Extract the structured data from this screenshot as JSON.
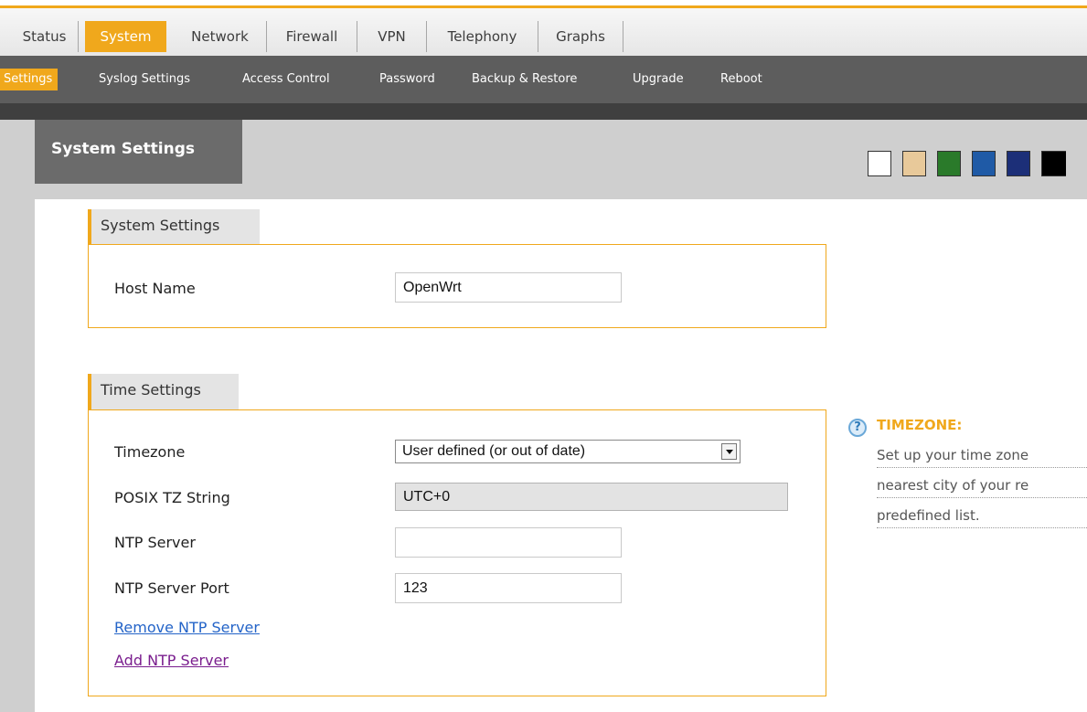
{
  "main_nav": {
    "tabs": [
      {
        "label": "Status",
        "active": false
      },
      {
        "label": "System",
        "active": true
      },
      {
        "label": "Network",
        "active": false
      },
      {
        "label": "Firewall",
        "active": false
      },
      {
        "label": "VPN",
        "active": false
      },
      {
        "label": "Telephony",
        "active": false
      },
      {
        "label": "Graphs",
        "active": false
      }
    ]
  },
  "sub_nav": {
    "items": [
      {
        "label": "Settings",
        "active": true
      },
      {
        "label": "Syslog Settings",
        "active": false
      },
      {
        "label": "Access Control",
        "active": false
      },
      {
        "label": "Password",
        "active": false
      },
      {
        "label": "Backup & Restore",
        "active": false
      },
      {
        "label": "Upgrade",
        "active": false
      },
      {
        "label": "Reboot",
        "active": false
      }
    ]
  },
  "page": {
    "heading": "System Settings"
  },
  "theme_swatches": [
    "#ffffff",
    "#e8c99a",
    "#2a7a2a",
    "#1f5aa6",
    "#1c2f78",
    "#000000"
  ],
  "system_section": {
    "title": "System Settings",
    "host_name_label": "Host Name",
    "host_name_value": "OpenWrt"
  },
  "time_section": {
    "title": "Time Settings",
    "timezone_label": "Timezone",
    "timezone_value": "User defined (or out of date)",
    "posix_label": "POSIX TZ String",
    "posix_value": "UTC+0",
    "ntp_server_label": "NTP Server",
    "ntp_server_value": "",
    "ntp_port_label": "NTP Server Port",
    "ntp_port_value": "123",
    "remove_link": "Remove NTP Server",
    "add_link": "Add NTP Server"
  },
  "help": {
    "icon": "question-icon",
    "title": "TIMEZONE:",
    "lines": [
      "Set up your time zone",
      "nearest city of your re",
      "predefined list."
    ]
  },
  "colors": {
    "accent": "#f0a81c",
    "subnav_bg": "#5d5d5d",
    "link_blue": "#2464c8",
    "link_visited": "#7a1e8e"
  }
}
